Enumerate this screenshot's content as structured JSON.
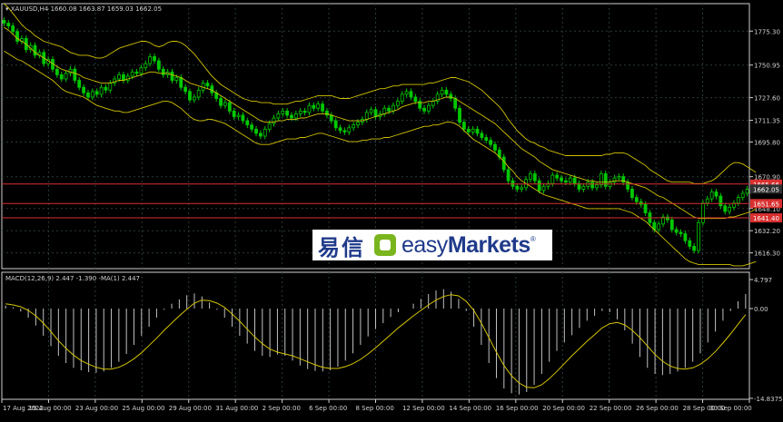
{
  "chart_data": [
    {
      "type": "candlestick",
      "title": "XAUUSD,H4  1660.08 1663.87 1659.03 1662.05",
      "symbol_label": "XAUUSD,H4",
      "ohlc_label": "1660.08 1663.87 1659.03 1662.05",
      "ylim": [
        1605,
        1795
      ],
      "y_ticks": [
        "1775.30",
        "1750.95",
        "1727.60",
        "1711.35",
        "1695.80",
        "1670.90",
        "1648.10",
        "1632.20",
        "1616.30"
      ],
      "y_tick_values": [
        1775.3,
        1750.95,
        1727.6,
        1711.35,
        1695.8,
        1670.9,
        1648.1,
        1632.2,
        1616.3
      ],
      "price_labels": [
        {
          "text": "1665.66",
          "value": 1665.66,
          "color": "#d93030"
        },
        {
          "text": "1662.05",
          "value": 1662.05,
          "color": "#303030"
        },
        {
          "text": "1651.65",
          "value": 1651.65,
          "color": "#d93030"
        },
        {
          "text": "1641.40",
          "value": 1641.4,
          "color": "#d93030"
        }
      ],
      "horizontal_lines": [
        1665.66,
        1651.65,
        1641.4
      ],
      "grid": true,
      "candle_color": "#00c800",
      "band_color": "#d4c400",
      "series": [
        {
          "name": "close",
          "values": [
            1781,
            1779,
            1775,
            1768,
            1770,
            1762,
            1765,
            1758,
            1760,
            1752,
            1755,
            1748,
            1744,
            1741,
            1745,
            1748,
            1740,
            1735,
            1731,
            1728,
            1732,
            1730,
            1735,
            1733,
            1738,
            1741,
            1744,
            1740,
            1743,
            1746,
            1745,
            1749,
            1752,
            1757,
            1754,
            1748,
            1744,
            1746,
            1740,
            1742,
            1735,
            1732,
            1726,
            1728,
            1733,
            1738,
            1736,
            1731,
            1727,
            1722,
            1724,
            1718,
            1714,
            1715,
            1711,
            1708,
            1705,
            1702,
            1700,
            1705,
            1709,
            1713,
            1716,
            1718,
            1715,
            1713,
            1716,
            1718,
            1717,
            1722,
            1720,
            1723,
            1718,
            1715,
            1711,
            1706,
            1704,
            1703,
            1706,
            1708,
            1710,
            1712,
            1717,
            1719,
            1714,
            1716,
            1720,
            1718,
            1722,
            1725,
            1730,
            1732,
            1728,
            1725,
            1720,
            1718,
            1722,
            1725,
            1730,
            1733,
            1730,
            1727,
            1720,
            1710,
            1705,
            1703,
            1705,
            1702,
            1699,
            1697,
            1694,
            1690,
            1685,
            1676,
            1668,
            1664,
            1662,
            1663,
            1669,
            1673,
            1668,
            1661,
            1664,
            1666,
            1672,
            1670,
            1668,
            1667,
            1670,
            1666,
            1662,
            1664,
            1667,
            1663,
            1665,
            1673,
            1664,
            1667,
            1670,
            1671,
            1667,
            1662,
            1656,
            1653,
            1651,
            1645,
            1638,
            1633,
            1637,
            1642,
            1640,
            1633,
            1631,
            1630,
            1625,
            1621,
            1618,
            1638,
            1652,
            1655,
            1660,
            1657,
            1650,
            1646,
            1649,
            1652,
            1656,
            1659,
            1662
          ]
        },
        {
          "name": "bb_upper",
          "values": [
            1795,
            1792,
            1788,
            1784,
            1780,
            1777,
            1775,
            1772,
            1770,
            1768,
            1767,
            1766,
            1765,
            1764,
            1762,
            1760,
            1759,
            1758,
            1758,
            1758,
            1757,
            1756,
            1756,
            1757,
            1759,
            1761,
            1763,
            1764,
            1765,
            1766,
            1767,
            1768,
            1768,
            1767,
            1765,
            1764,
            1765,
            1767,
            1768,
            1768,
            1767,
            1765,
            1762,
            1759,
            1755,
            1751,
            1747,
            1743,
            1740,
            1737,
            1735,
            1733,
            1731,
            1729,
            1727,
            1726,
            1725,
            1725,
            1724,
            1724,
            1724,
            1723,
            1723,
            1723,
            1723,
            1724,
            1725,
            1725,
            1726,
            1727,
            1728,
            1729,
            1729,
            1729,
            1729,
            1728,
            1727,
            1727,
            1727,
            1728,
            1729,
            1730,
            1731,
            1732,
            1733,
            1734,
            1734,
            1735,
            1736,
            1736,
            1737,
            1737,
            1737,
            1737,
            1737,
            1737,
            1738,
            1738,
            1739,
            1740,
            1741,
            1742,
            1742,
            1741,
            1740,
            1739,
            1737,
            1735,
            1733,
            1730,
            1727,
            1724,
            1721,
            1717,
            1712,
            1708,
            1704,
            1701,
            1698,
            1696,
            1695,
            1693,
            1692,
            1690,
            1689,
            1688,
            1687,
            1686,
            1686,
            1686,
            1686,
            1686,
            1686,
            1686,
            1686,
            1686,
            1687,
            1687,
            1688,
            1688,
            1688,
            1687,
            1685,
            1683,
            1681,
            1679,
            1676,
            1674,
            1672,
            1670,
            1668,
            1667,
            1667,
            1667,
            1667,
            1667,
            1666,
            1666,
            1666,
            1667,
            1668,
            1670,
            1673,
            1676,
            1679,
            1681,
            1681,
            1680,
            1678,
            1676,
            1674
          ]
        },
        {
          "name": "bb_middle",
          "values": [
            1778,
            1776,
            1773,
            1770,
            1768,
            1766,
            1763,
            1760,
            1758,
            1756,
            1754,
            1752,
            1750,
            1748,
            1747,
            1746,
            1745,
            1744,
            1742,
            1741,
            1740,
            1739,
            1738,
            1738,
            1738,
            1739,
            1740,
            1740,
            1741,
            1742,
            1743,
            1744,
            1745,
            1746,
            1746,
            1745,
            1745,
            1745,
            1744,
            1743,
            1742,
            1740,
            1738,
            1737,
            1736,
            1735,
            1734,
            1733,
            1731,
            1729,
            1727,
            1725,
            1723,
            1721,
            1719,
            1717,
            1715,
            1713,
            1711,
            1710,
            1710,
            1710,
            1711,
            1711,
            1712,
            1712,
            1712,
            1713,
            1713,
            1714,
            1715,
            1716,
            1716,
            1716,
            1715,
            1714,
            1713,
            1712,
            1711,
            1711,
            1711,
            1711,
            1712,
            1713,
            1714,
            1715,
            1716,
            1717,
            1718,
            1719,
            1721,
            1722,
            1723,
            1724,
            1724,
            1724,
            1725,
            1725,
            1726,
            1727,
            1728,
            1728,
            1727,
            1725,
            1723,
            1721,
            1719,
            1717,
            1715,
            1713,
            1711,
            1709,
            1706,
            1703,
            1700,
            1697,
            1694,
            1691,
            1689,
            1687,
            1685,
            1682,
            1680,
            1678,
            1676,
            1675,
            1674,
            1673,
            1672,
            1671,
            1670,
            1669,
            1668,
            1668,
            1667,
            1667,
            1667,
            1667,
            1668,
            1668,
            1668,
            1667,
            1666,
            1665,
            1664,
            1663,
            1661,
            1659,
            1657,
            1656,
            1654,
            1652,
            1650,
            1648,
            1646,
            1644,
            1642,
            1641,
            1641,
            1641,
            1641,
            1641,
            1641,
            1641,
            1642,
            1642,
            1643,
            1644,
            1645,
            1646,
            1648
          ]
        },
        {
          "name": "bb_lower",
          "values": [
            1761,
            1759,
            1757,
            1755,
            1754,
            1752,
            1750,
            1748,
            1746,
            1744,
            1742,
            1740,
            1737,
            1734,
            1732,
            1731,
            1730,
            1729,
            1728,
            1726,
            1724,
            1722,
            1721,
            1720,
            1719,
            1718,
            1718,
            1717,
            1717,
            1718,
            1719,
            1720,
            1721,
            1722,
            1723,
            1724,
            1725,
            1725,
            1724,
            1722,
            1720,
            1717,
            1714,
            1712,
            1711,
            1711,
            1712,
            1712,
            1711,
            1710,
            1709,
            1707,
            1705,
            1703,
            1701,
            1699,
            1697,
            1695,
            1694,
            1694,
            1694,
            1695,
            1696,
            1697,
            1698,
            1698,
            1698,
            1699,
            1699,
            1700,
            1701,
            1702,
            1702,
            1701,
            1700,
            1699,
            1698,
            1697,
            1696,
            1696,
            1696,
            1697,
            1697,
            1698,
            1698,
            1698,
            1699,
            1699,
            1700,
            1701,
            1702,
            1703,
            1704,
            1705,
            1706,
            1707,
            1707,
            1708,
            1708,
            1709,
            1710,
            1710,
            1709,
            1707,
            1704,
            1701,
            1698,
            1696,
            1694,
            1692,
            1690,
            1688,
            1685,
            1682,
            1678,
            1675,
            1671,
            1668,
            1666,
            1664,
            1662,
            1660,
            1658,
            1657,
            1656,
            1655,
            1654,
            1653,
            1652,
            1651,
            1650,
            1649,
            1648,
            1648,
            1648,
            1648,
            1648,
            1648,
            1648,
            1648,
            1647,
            1646,
            1645,
            1643,
            1641,
            1639,
            1636,
            1633,
            1630,
            1627,
            1624,
            1621,
            1618,
            1615,
            1612,
            1610,
            1609,
            1608,
            1608,
            1608,
            1608,
            1608,
            1608,
            1608,
            1608,
            1607,
            1607,
            1607,
            1608,
            1609,
            1610
          ]
        }
      ]
    },
    {
      "type": "macd",
      "title": "MACD(12,26,9) 2.447 -1.390 -MA(1) 2.447",
      "label": "MACD(12,26,9) 2.447 -1.390 -MA(1) 2.447",
      "ylim": [
        -15,
        6
      ],
      "y_ticks": [
        "4.797",
        "0.00",
        "-14.8375"
      ],
      "y_tick_values": [
        4.797,
        0,
        -14.8375
      ],
      "histogram_color": "#c0c0c0",
      "signal_color": "#d4c400",
      "x_labels": [
        "17 Aug 2022",
        "19 Aug 00:00",
        "23 Aug 00:00",
        "25 Aug 00:00",
        "29 Aug 00:00",
        "31 Aug 00:00",
        "2 Sep 00:00",
        "6 Sep 00:00",
        "8 Sep 00:00",
        "12 Sep 00:00",
        "14 Sep 00:00",
        "16 Sep 00:00",
        "20 Sep 00:00",
        "22 Sep 00:00",
        "26 Sep 00:00",
        "28 Sep 00:00",
        "30 Sep 00:00"
      ],
      "series": [
        {
          "name": "macd",
          "values": [
            0.5,
            0.2,
            -0.5,
            -1.5,
            -2.8,
            -4.5,
            -6.2,
            -7.8,
            -9.0,
            -9.8,
            -10.2,
            -10.5,
            -10.6,
            -10.4,
            -9.8,
            -8.8,
            -7.5,
            -6.0,
            -4.5,
            -3.0,
            -1.5,
            -0.2,
            0.8,
            1.5,
            2.2,
            2.5,
            2.0,
            1.0,
            -0.2,
            -1.5,
            -3.0,
            -4.5,
            -5.8,
            -7.0,
            -7.8,
            -8.0,
            -7.6,
            -7.8,
            -8.6,
            -9.4,
            -10.0,
            -10.3,
            -10.4,
            -10.2,
            -9.6,
            -8.6,
            -7.4,
            -6.0,
            -4.6,
            -3.4,
            -2.4,
            -1.4,
            -0.6,
            0.0,
            0.8,
            1.6,
            2.4,
            3.0,
            3.2,
            2.8,
            1.6,
            -0.4,
            -3.0,
            -6.0,
            -9.0,
            -11.5,
            -13.2,
            -14.0,
            -14.2,
            -13.8,
            -12.6,
            -10.8,
            -8.8,
            -7.0,
            -5.6,
            -4.4,
            -3.2,
            -2.0,
            -1.2,
            -0.4,
            -0.6,
            -1.8,
            -3.6,
            -5.8,
            -8.0,
            -9.8,
            -10.8,
            -11.0,
            -10.8,
            -10.4,
            -9.8,
            -8.8,
            -7.4,
            -5.6,
            -3.8,
            -2.0,
            -0.4,
            1.2,
            2.4
          ]
        },
        {
          "name": "signal",
          "values": [
            0.8,
            0.6,
            0.3,
            -0.3,
            -1.2,
            -2.4,
            -3.8,
            -5.3,
            -6.6,
            -7.7,
            -8.6,
            -9.2,
            -9.7,
            -10.0,
            -10.0,
            -9.7,
            -9.1,
            -8.3,
            -7.3,
            -6.1,
            -4.9,
            -3.6,
            -2.4,
            -1.2,
            -0.1,
            0.9,
            1.4,
            1.3,
            0.9,
            0.2,
            -0.9,
            -2.1,
            -3.4,
            -4.7,
            -5.8,
            -6.7,
            -7.2,
            -7.5,
            -7.8,
            -8.3,
            -8.8,
            -9.3,
            -9.7,
            -9.9,
            -9.9,
            -9.6,
            -9.1,
            -8.4,
            -7.5,
            -6.5,
            -5.4,
            -4.3,
            -3.2,
            -2.2,
            -1.2,
            -0.3,
            0.6,
            1.4,
            2.0,
            2.3,
            2.1,
            1.2,
            -0.3,
            -2.4,
            -4.8,
            -7.2,
            -9.4,
            -11.1,
            -12.3,
            -13.0,
            -13.1,
            -12.6,
            -11.6,
            -10.4,
            -9.1,
            -7.8,
            -6.6,
            -5.4,
            -4.3,
            -3.2,
            -2.5,
            -2.3,
            -2.7,
            -3.6,
            -4.8,
            -6.2,
            -7.6,
            -8.7,
            -9.5,
            -9.9,
            -10.0,
            -9.8,
            -9.2,
            -8.3,
            -7.1,
            -5.7,
            -4.2,
            -2.6,
            -1.0
          ]
        }
      ]
    }
  ],
  "watermark": {
    "cn": "易信",
    "en_light": "easy",
    "en_bold": "Markets",
    "reg": "®"
  }
}
